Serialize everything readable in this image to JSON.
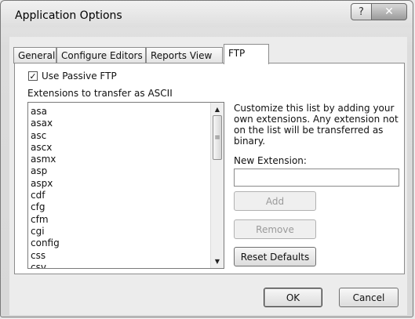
{
  "window": {
    "title": "Application Options",
    "help_glyph": "?",
    "close_glyph": "✕"
  },
  "tabs": [
    {
      "label": "General"
    },
    {
      "label": "Configure Editors"
    },
    {
      "label": "Reports View"
    },
    {
      "label": "FTP",
      "selected": true
    }
  ],
  "ftp": {
    "passive_checkbox": {
      "label": "Use Passive FTP",
      "checked": true,
      "glyph": "✓"
    },
    "extensions_label": "Extensions to transfer as ASCII",
    "extensions": [
      "asa",
      "asax",
      "asc",
      "ascx",
      "asmx",
      "asp",
      "aspx",
      "cdf",
      "cfg",
      "cfm",
      "cgi",
      "config",
      "css",
      "csv"
    ],
    "description": "Customize this list by adding your own extensions.  Any extension not on the list will be transferred as binary.",
    "new_extension_label": "New Extension:",
    "new_extension_value": "",
    "add_label": "Add",
    "remove_label": "Remove",
    "reset_label": "Reset Defaults"
  },
  "footer": {
    "ok_label": "OK",
    "cancel_label": "Cancel"
  },
  "scrollbar": {
    "up_glyph": "▲",
    "down_glyph": "▼",
    "thumb_glyph": "≡"
  }
}
